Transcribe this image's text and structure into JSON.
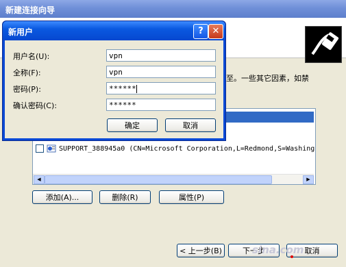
{
  "wizard": {
    "title": "新建连接向导",
    "description_fragment": "至。一些其它因素，如禁",
    "list_rows": [
      {
        "label": "SUPPORT_388945a0 (CN=Microsoft Corporation,L=Redmond,S=Washing"
      }
    ],
    "buttons": {
      "add": "添加(A)...",
      "delete": "删除(R)",
      "properties": "属性(P)"
    },
    "nav": {
      "back": "< 上一步(B)",
      "next": "下一步",
      "cancel": "取消"
    }
  },
  "dialog": {
    "title": "新用户",
    "help_glyph": "?",
    "close_glyph": "✕",
    "fields": {
      "username": {
        "label": "用户名(U):",
        "value": "vpn"
      },
      "fullname": {
        "label": "全称(F):",
        "value": "vpn"
      },
      "password": {
        "label": "密码(P):",
        "value": "******"
      },
      "confirm": {
        "label": "确认密码(C):",
        "value": "******"
      }
    },
    "ok": "确定",
    "cancel": "取消"
  },
  "watermark": "sina.com"
}
